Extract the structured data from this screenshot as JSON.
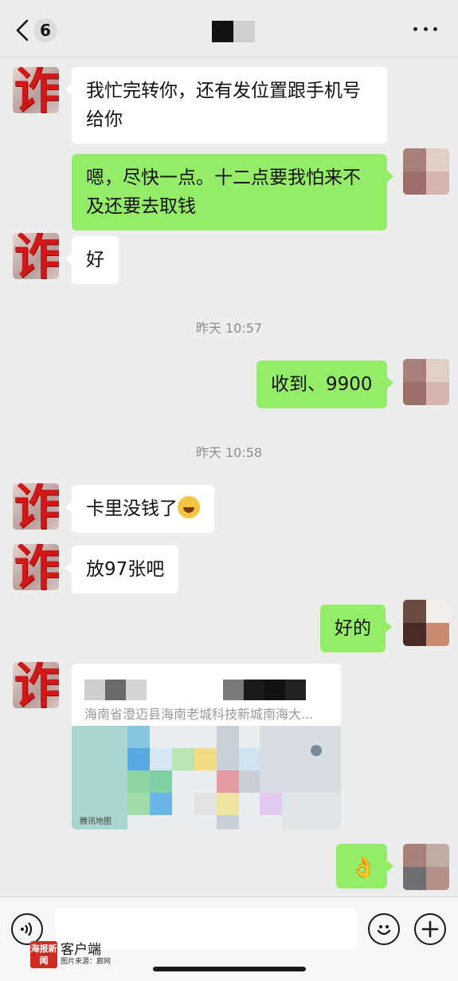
{
  "header": {
    "unread_count": "6",
    "back_icon": "chevron-left-icon",
    "more_icon": "more-dots-icon"
  },
  "avatar_scam_label": "诈",
  "messages": [
    {
      "side": "left",
      "text": "我忙完转你，还有发位置跟手机号给你"
    },
    {
      "side": "right",
      "text": "嗯，尽快一点。十二点要我怕来不及还要去取钱"
    },
    {
      "side": "left",
      "text": "好"
    },
    {
      "side": "right",
      "text": "收到、9900"
    },
    {
      "side": "left",
      "text": "卡里没钱了"
    },
    {
      "side": "left",
      "text": "放97张吧"
    },
    {
      "side": "right",
      "text": "好的"
    },
    {
      "side": "right",
      "text": "👌"
    }
  ],
  "timestamps": [
    "昨天 10:57",
    "昨天 10:58"
  ],
  "location": {
    "address": "海南省澄迈县海南老城科技新城南海大...",
    "map_provider": "腾讯地图"
  },
  "input_bar": {
    "voice_icon": "voice-icon",
    "emoji_icon": "emoji-icon",
    "add_icon": "plus-icon"
  },
  "watermark": {
    "logo_text": "海报新闻",
    "name": "客户端",
    "source": "图片来源：廊网"
  }
}
